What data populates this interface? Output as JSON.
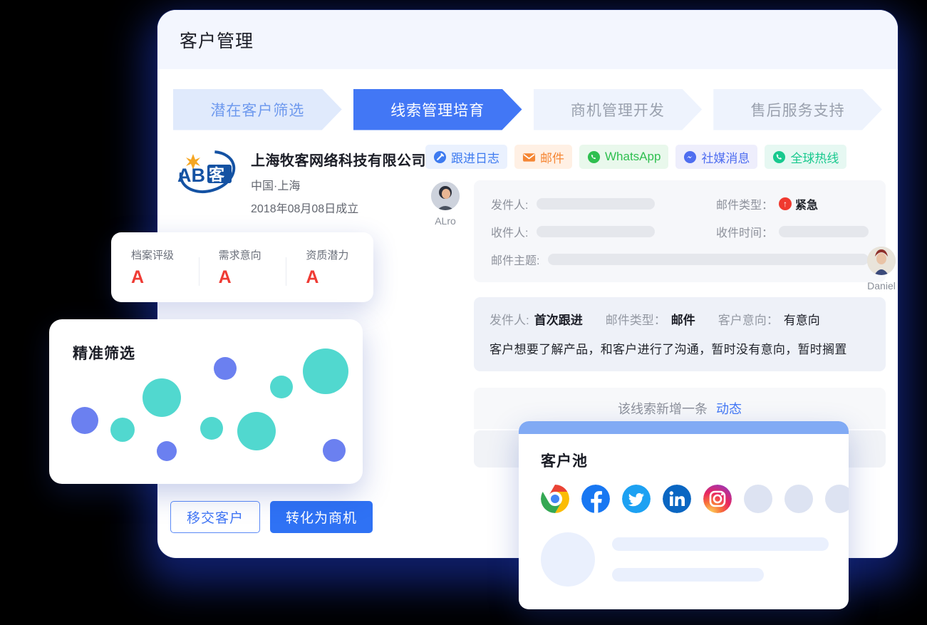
{
  "window": {
    "title": "客户管理"
  },
  "steps": [
    {
      "label": "潜在客户筛选",
      "state": "done"
    },
    {
      "label": "线索管理培育",
      "state": "active"
    },
    {
      "label": "商机管理开发",
      "state": "todo"
    },
    {
      "label": "售后服务支持",
      "state": "todo"
    }
  ],
  "company": {
    "logo_text": "AB客",
    "name": "上海牧客网络科技有限公司",
    "location": "中国·上海",
    "founded": "2018年08月08日成立"
  },
  "ratings": [
    {
      "label": "档案评级",
      "value": "A"
    },
    {
      "label": "需求意向",
      "value": "A"
    },
    {
      "label": "资质潜力",
      "value": "A"
    }
  ],
  "actions": {
    "transfer_label": "移交客户",
    "convert_label": "转化为商机"
  },
  "channels": [
    {
      "label": "跟进日志",
      "icon": "log-icon",
      "color": "#3e7bf0"
    },
    {
      "label": "邮件",
      "icon": "envelope-icon",
      "color": "#f58634"
    },
    {
      "label": "WhatsApp",
      "icon": "whatsapp-icon",
      "color": "#2ebf4f"
    },
    {
      "label": "社媒消息",
      "icon": "messenger-icon",
      "color": "#4f6ef0"
    },
    {
      "label": "全球热线",
      "icon": "phone-icon",
      "color": "#18c98e"
    }
  ],
  "mail": {
    "user_name": "ALro",
    "sender_label": "发件人:",
    "receiver_label": "收件人:",
    "subject_label": "邮件主题:",
    "type_label": "邮件类型：",
    "time_label": "收件时间：",
    "type_value": "紧急"
  },
  "note": {
    "sender_label": "发件人:",
    "sender_value": "首次跟进",
    "type_label": "邮件类型：",
    "type_value": "邮件",
    "intent_label": "客户意向：",
    "intent_value": "有意向",
    "body": "客户想要了解产品，和客户进行了沟通，暂时没有意向，暂时搁置",
    "reviewer_name": "Daniel"
  },
  "activity": {
    "text": "该线索新增一条",
    "link": "动态"
  },
  "bubbles": {
    "title": "精准筛选",
    "colors": {
      "blue": "#6b80f0",
      "teal": "#51d8cf"
    }
  },
  "pool": {
    "title": "客户池",
    "icons": [
      "chrome-icon",
      "facebook-icon",
      "twitter-icon",
      "linkedin-icon",
      "instagram-icon",
      "placeholder",
      "placeholder",
      "placeholder"
    ]
  },
  "chart_data": {
    "type": "scatter",
    "title": "精准筛选",
    "xlabel": "",
    "ylabel": "",
    "series": [
      {
        "name": "blue",
        "color": "#6b80f0",
        "points": [
          {
            "x": 50,
            "y": 142,
            "r": 19
          },
          {
            "x": 165,
            "y": 185,
            "r": 14
          },
          {
            "x": 247,
            "y": 69,
            "r": 16
          },
          {
            "x": 400,
            "y": 184,
            "r": 16
          }
        ]
      },
      {
        "name": "teal",
        "color": "#51d8cf",
        "points": [
          {
            "x": 103,
            "y": 155,
            "r": 17
          },
          {
            "x": 158,
            "y": 110,
            "r": 27
          },
          {
            "x": 228,
            "y": 153,
            "r": 16
          },
          {
            "x": 291,
            "y": 157,
            "r": 27
          },
          {
            "x": 326,
            "y": 95,
            "r": 16
          },
          {
            "x": 388,
            "y": 73,
            "r": 32
          }
        ]
      }
    ]
  }
}
